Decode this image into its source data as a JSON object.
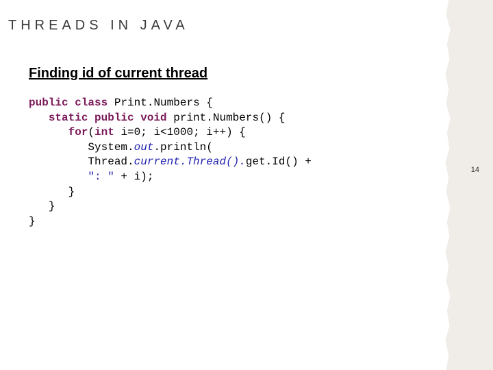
{
  "slide": {
    "title": "THREADS IN JAVA",
    "section_title": "Finding id of current thread",
    "page_number": "14"
  },
  "code": {
    "kw_public": "public",
    "kw_class": "class",
    "kw_static": "static",
    "kw_void": "void",
    "kw_for": "for",
    "kw_int": "int",
    "name_PrintNumbers": "Print.Numbers",
    "name_printNumbers": "print.Numbers()",
    "ident_out": "out",
    "ident_currentThread": "current.Thread().",
    "str_colon": "\": \"",
    "line1_tail": " {",
    "line2_tail": " {",
    "line3_mid_a": "(",
    "line3_mid_b": " i=0; i<1000; i++) {",
    "line4": "System.",
    "line4_tail": ".println(",
    "line5": "Thread.",
    "line5_tail": "get.Id() +",
    "line6_tail": " + i);",
    "brace": "}"
  }
}
